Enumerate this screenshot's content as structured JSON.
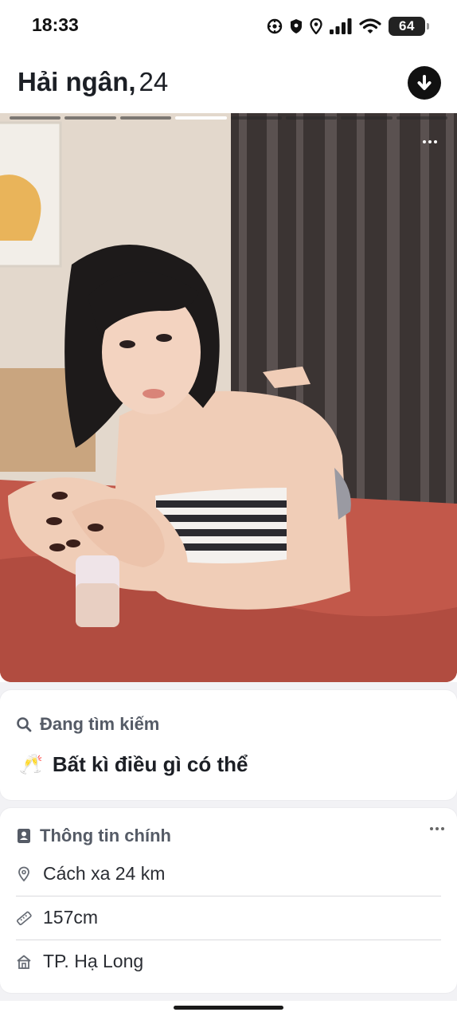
{
  "status_bar": {
    "time": "18:33",
    "battery": "64",
    "icons": [
      "focus-icon",
      "shield-location-icon",
      "location-icon",
      "signal-icon",
      "wifi-icon",
      "battery-icon"
    ]
  },
  "profile": {
    "name": "Hải ngân,",
    "age": "24"
  },
  "photo": {
    "total_photos": 8,
    "current_photo": 4
  },
  "looking_for": {
    "heading": "Đang tìm kiếm",
    "emoji": "🥂",
    "value": "Bất kì điều gì có thể"
  },
  "basics": {
    "heading": "Thông tin chính",
    "rows": [
      {
        "icon": "location-pin-icon",
        "text": "Cách xa 24 km"
      },
      {
        "icon": "ruler-icon",
        "text": "157cm"
      },
      {
        "icon": "home-icon",
        "text": "TP. Hạ Long"
      }
    ]
  },
  "colors": {
    "accent_dark": "#111111",
    "card_heading": "#555b66",
    "bed_red": "#c2584a"
  }
}
